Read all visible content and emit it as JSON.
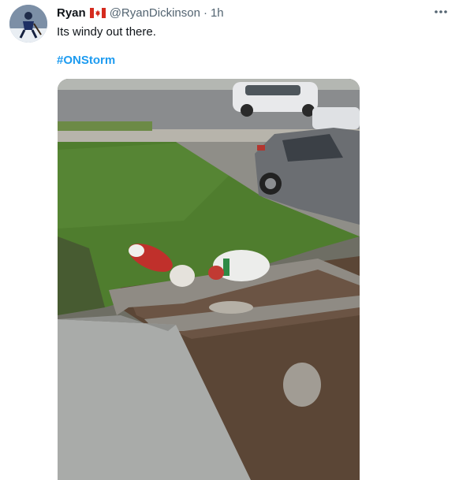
{
  "tweet": {
    "author": {
      "display_name": "Ryan",
      "flag_icon": "canada-flag-icon",
      "handle": "@RyanDickinson",
      "separator": "·",
      "timestamp": "1h"
    },
    "text": "Its windy out there.",
    "hashtag": "#ONStorm",
    "more_icon": "more-options-icon",
    "colors": {
      "link": "#1d9bf0",
      "secondary_text": "#536471",
      "primary_text": "#0f1419"
    }
  }
}
